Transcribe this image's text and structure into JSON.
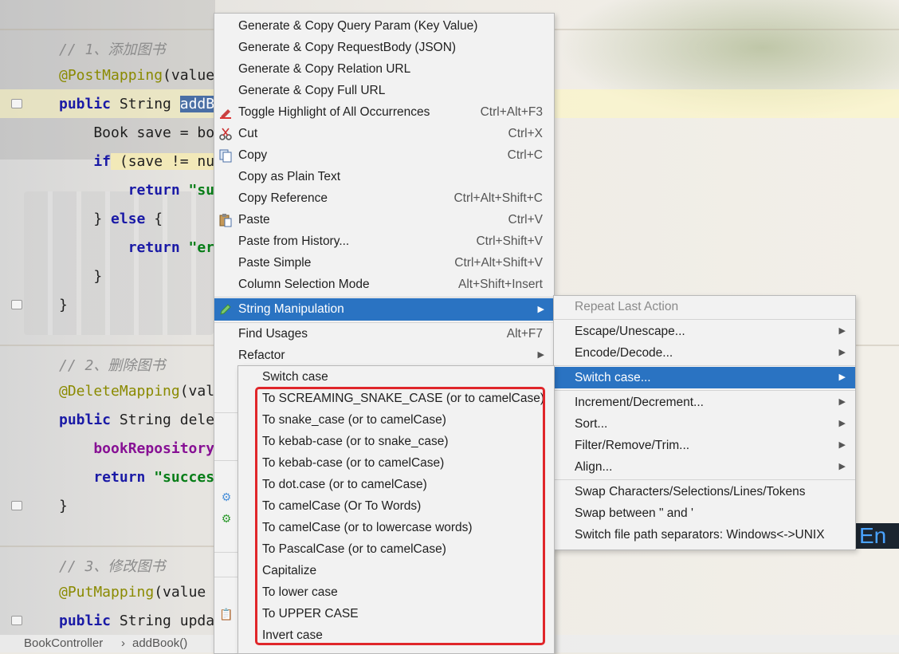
{
  "editor": {
    "lines": [
      {
        "comment": "// 1、添加图书"
      },
      {
        "anno": "@PostMapping",
        "rest": "(value"
      },
      {
        "kw": "public",
        "text": " String ",
        "sel": "addB"
      },
      {
        "text": "    Book save = bo"
      },
      {
        "kw": "    if",
        "text": " (save != nu"
      },
      {
        "kw": "        return",
        "str": " \"su"
      },
      {
        "text": "    } ",
        "kw2": "else",
        "text2": " {"
      },
      {
        "kw": "        return",
        "str": " \"er"
      },
      {
        "text": "    }"
      },
      {
        "text": "}"
      },
      {
        "comment": "// 2、删除图书"
      },
      {
        "anno": "@DeleteMapping",
        "rest": "(val"
      },
      {
        "kw": "public",
        "text": " String dele"
      },
      {
        "field": "    bookRepository"
      },
      {
        "kw": "    return",
        "str": " \"succes"
      },
      {
        "text": "}"
      },
      {
        "comment": "// 3、修改图书"
      },
      {
        "anno": "@PutMapping",
        "rest": "(value"
      },
      {
        "kw": "public",
        "text": " String upda"
      }
    ],
    "breadcrumb": [
      "BookController",
      "addBook()"
    ],
    "breadcrumb_separator": "›",
    "ime_badge": "En"
  },
  "main_menu": {
    "items": [
      {
        "label": "Generate & Copy Query Param (Key Value)",
        "shortcut": "",
        "icon": ""
      },
      {
        "label": "Generate & Copy RequestBody (JSON)",
        "shortcut": "",
        "icon": ""
      },
      {
        "label": "Generate & Copy Relation URL",
        "shortcut": "",
        "icon": ""
      },
      {
        "label": "Generate & Copy Full URL",
        "shortcut": "",
        "icon": ""
      },
      {
        "label": "Toggle Highlight of All Occurrences",
        "shortcut": "Ctrl+Alt+F3",
        "icon": "highlight-icon"
      },
      {
        "label": "Cut",
        "shortcut": "Ctrl+X",
        "icon": "scissors-icon"
      },
      {
        "label": "Copy",
        "shortcut": "Ctrl+C",
        "icon": "copy-icon"
      },
      {
        "label": "Copy as Plain Text",
        "shortcut": "",
        "icon": ""
      },
      {
        "label": "Copy Reference",
        "shortcut": "Ctrl+Alt+Shift+C",
        "icon": ""
      },
      {
        "label": "Paste",
        "shortcut": "Ctrl+V",
        "icon": "paste-icon"
      },
      {
        "label": "Paste from History...",
        "shortcut": "Ctrl+Shift+V",
        "icon": ""
      },
      {
        "label": "Paste Simple",
        "shortcut": "Ctrl+Alt+Shift+V",
        "icon": ""
      },
      {
        "label": "Column Selection Mode",
        "shortcut": "Alt+Shift+Insert",
        "icon": ""
      },
      {
        "label": "String Manipulation",
        "shortcut": "",
        "icon": "pencil-icon"
      },
      {
        "label": "Find Usages",
        "shortcut": "Alt+F7",
        "icon": ""
      },
      {
        "label": "Refactor",
        "shortcut": "",
        "icon": ""
      }
    ]
  },
  "string_manipulation_menu": {
    "items": [
      {
        "label": "Repeat Last Action"
      },
      {
        "label": "Escape/Unescape..."
      },
      {
        "label": "Encode/Decode..."
      },
      {
        "label": "Switch case..."
      },
      {
        "label": "Increment/Decrement..."
      },
      {
        "label": "Sort..."
      },
      {
        "label": "Filter/Remove/Trim..."
      },
      {
        "label": "Align..."
      },
      {
        "label": "Swap Characters/Selections/Lines/Tokens"
      },
      {
        "label": "Swap between \" and '"
      },
      {
        "label": "Switch file path separators: Windows<->UNIX"
      }
    ]
  },
  "switch_case_menu": {
    "items": [
      {
        "label": "Switch case"
      },
      {
        "label": "To SCREAMING_SNAKE_CASE (or to camelCase)"
      },
      {
        "label": "To snake_case (or to camelCase)"
      },
      {
        "label": "To kebab-case (or to snake_case)"
      },
      {
        "label": "To kebab-case (or to camelCase)"
      },
      {
        "label": "To dot.case (or to camelCase)"
      },
      {
        "label": "To camelCase (Or To Words)"
      },
      {
        "label": "To camelCase (or to lowercase words)"
      },
      {
        "label": "To PascalCase (or to camelCase)"
      },
      {
        "label": "Capitalize"
      },
      {
        "label": "To lower case"
      },
      {
        "label": "To UPPER CASE"
      },
      {
        "label": "Invert case"
      }
    ]
  },
  "colors": {
    "menu_selection": "#2a73c2",
    "highlight_box": "#e0262a"
  }
}
